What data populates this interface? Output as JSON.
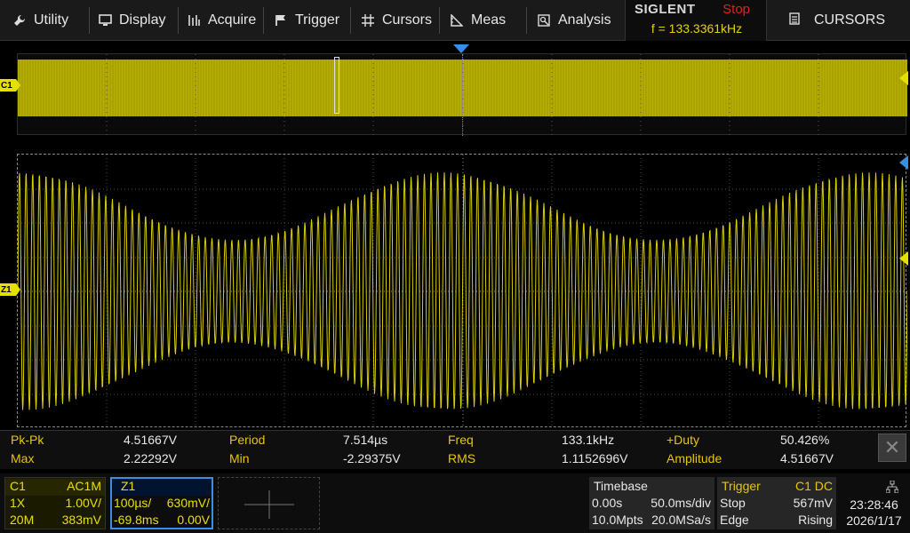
{
  "menu": {
    "items": [
      {
        "label": "Utility",
        "icon": "wrench-icon"
      },
      {
        "label": "Display",
        "icon": "monitor-icon"
      },
      {
        "label": "Acquire",
        "icon": "acquire-icon"
      },
      {
        "label": "Trigger",
        "icon": "flag-icon"
      },
      {
        "label": "Cursors",
        "icon": "crosshair-icon"
      },
      {
        "label": "Meas",
        "icon": "ruler-icon"
      },
      {
        "label": "Analysis",
        "icon": "analysis-icon"
      }
    ],
    "brand": "SIGLENT",
    "run_state": "Stop",
    "freq_readout": "f = 133.3361kHz",
    "active_function": "CURSORS"
  },
  "markers": {
    "channel1": "C1",
    "zoom1": "Z1"
  },
  "measurements": {
    "row1": [
      {
        "label": "Pk-Pk",
        "value": "4.51667V"
      },
      {
        "label": "Period",
        "value": "7.514µs"
      },
      {
        "label": "Freq",
        "value": "133.1kHz"
      },
      {
        "label": "+Duty",
        "value": "50.426%"
      }
    ],
    "row2": [
      {
        "label": "Max",
        "value": "2.22292V"
      },
      {
        "label": "Min",
        "value": "-2.29375V"
      },
      {
        "label": "RMS",
        "value": "1.1152696V"
      },
      {
        "label": "Amplitude",
        "value": "4.51667V"
      }
    ],
    "close_icon": "close-icon"
  },
  "channel1": {
    "name": "C1",
    "coupling": "AC1M",
    "probe": "1X",
    "scale": "1.00V/",
    "bandwidth": "20M",
    "offset": "383mV"
  },
  "zoom1": {
    "name": "Z1",
    "timescale": "100µs/",
    "vscale": "630mV/",
    "delay": "-69.8ms",
    "offset": "0.00V"
  },
  "timebase": {
    "title": "Timebase",
    "delay": "0.00s",
    "scale": "50.0ms/div",
    "memory": "10.0Mpts",
    "sample_rate": "20.0MSa/s"
  },
  "trigger": {
    "title": "Trigger",
    "source": "C1 DC",
    "state": "Stop",
    "level": "567mV",
    "type": "Edge",
    "slope": "Rising"
  },
  "clock": {
    "time": "23:28:46",
    "date": "2026/1/17",
    "network_icon": "network-icon"
  },
  "colors": {
    "channel": "#e6e000",
    "accent_blue": "#3a8ee8",
    "stop_red": "#e02020",
    "label_yellow": "#e8c800"
  }
}
